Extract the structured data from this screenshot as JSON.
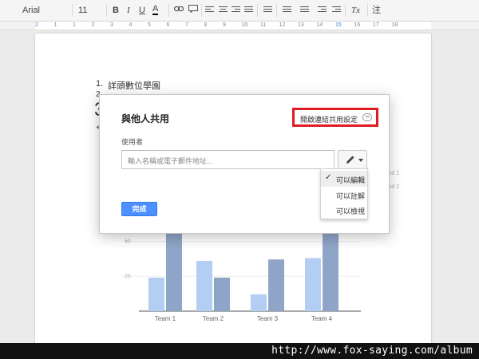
{
  "toolbar": {
    "font": "Arial",
    "size": "11",
    "bold": "B",
    "italic": "I",
    "underline": "U",
    "text_color": "A",
    "clear_format": "Tx",
    "input_tools": "注"
  },
  "ruler": {
    "numbers": [
      "2",
      "1",
      "1",
      "2",
      "3",
      "4",
      "5",
      "6",
      "7",
      "8",
      "9",
      "10",
      "11",
      "12",
      "13",
      "14",
      "15",
      "16",
      "17",
      "18"
    ]
  },
  "doc": {
    "line1_prefix": "1.",
    "line1_text": "詳頭數位學園",
    "line2_prefix": "2",
    "big_char": "3",
    "plus_char": "+"
  },
  "dialog": {
    "title": "與他人共用",
    "link_setting": "開啟連結共用設定",
    "link_icon": "link-icon",
    "people_label": "使用者",
    "input_placeholder": "輸入名稱或電子郵件地址...",
    "done_label": "完成"
  },
  "menu": {
    "items": [
      "可以編輯",
      "可以註解",
      "可以檢視"
    ],
    "selected": "可以編輯"
  },
  "chart_data": {
    "type": "bar",
    "categories": [
      "Team 1",
      "Team 2",
      "Team 3",
      "Team 4"
    ],
    "series": [
      {
        "name": "Period 1",
        "values": [
          24,
          36,
          12,
          38
        ]
      },
      {
        "name": "Period 2",
        "values": [
          75,
          24,
          37,
          75
        ]
      }
    ],
    "yticks": [
      "25",
      "50"
    ],
    "colors": [
      "#b3cdf3",
      "#8fa5c7"
    ]
  },
  "watermark": {
    "text": "http://www.fox-saying.com/album"
  }
}
